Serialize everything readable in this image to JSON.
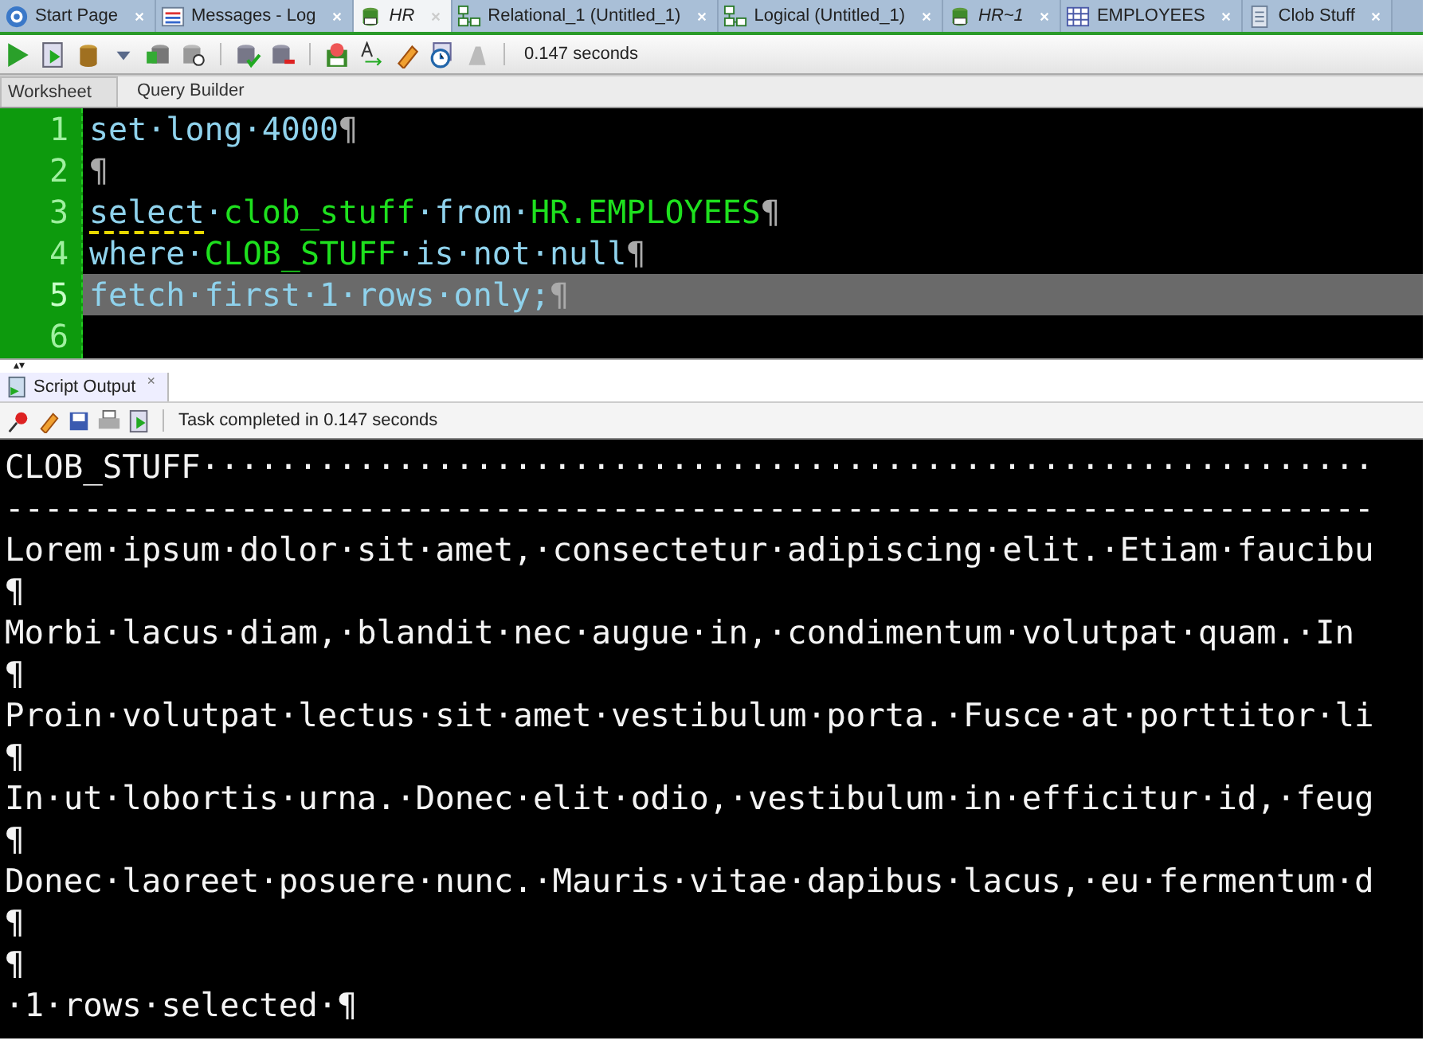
{
  "editor_tabs": [
    {
      "label": "Start Page",
      "italic": false,
      "selected": false
    },
    {
      "label": "Messages - Log",
      "italic": false,
      "selected": false
    },
    {
      "label": "HR",
      "italic": true,
      "selected": true
    },
    {
      "label": "Relational_1 (Untitled_1)",
      "italic": false,
      "selected": false
    },
    {
      "label": "Logical (Untitled_1)",
      "italic": false,
      "selected": false
    },
    {
      "label": "HR~1",
      "italic": true,
      "selected": false
    },
    {
      "label": "EMPLOYEES",
      "italic": false,
      "selected": false
    },
    {
      "label": "Clob Stuff",
      "italic": false,
      "selected": false
    }
  ],
  "toolbar": {
    "timing": "0.147 seconds"
  },
  "sub_tabs": [
    {
      "label": "Worksheet",
      "selected": true
    },
    {
      "label": "Query Builder",
      "selected": false
    }
  ],
  "editor": {
    "lines": [
      {
        "number": "1",
        "current": false,
        "segments": [
          {
            "kind": "keyword",
            "text": "set·long·4000"
          },
          {
            "kind": "marker",
            "text": "¶"
          }
        ]
      },
      {
        "number": "2",
        "current": false,
        "segments": [
          {
            "kind": "marker",
            "text": "¶"
          }
        ]
      },
      {
        "number": "3",
        "current": false,
        "segments": [
          {
            "kind": "keyword",
            "text": "select",
            "warning": true
          },
          {
            "kind": "keyword",
            "text": "·"
          },
          {
            "kind": "identifier",
            "text": "clob_stuff"
          },
          {
            "kind": "keyword",
            "text": "·from·"
          },
          {
            "kind": "identifier",
            "text": "HR.EMPLOYEES"
          },
          {
            "kind": "marker",
            "text": "¶"
          }
        ]
      },
      {
        "number": "4",
        "current": false,
        "segments": [
          {
            "kind": "keyword",
            "text": "where·"
          },
          {
            "kind": "identifier",
            "text": "CLOB_STUFF"
          },
          {
            "kind": "keyword",
            "text": "·is·not·null"
          },
          {
            "kind": "marker",
            "text": "¶"
          }
        ]
      },
      {
        "number": "5",
        "current": true,
        "segments": [
          {
            "kind": "keyword",
            "text": "fetch·first·1·rows·only;"
          },
          {
            "kind": "marker",
            "text": "¶"
          }
        ]
      },
      {
        "number": "6",
        "current": false
      }
    ]
  },
  "output_panel": {
    "tab": {
      "label": "Script Output",
      "close": "×"
    },
    "status": "Task completed in 0.147 seconds",
    "lines": [
      "CLOB_STUFF····························································",
      "----------------------------------------------------------------------",
      "Lorem·ipsum·dolor·sit·amet,·consectetur·adipiscing·elit.·Etiam·faucibu",
      "¶",
      "Morbi·lacus·diam,·blandit·nec·augue·in,·condimentum·volutpat·quam.·In",
      "¶",
      "Proin·volutpat·lectus·sit·amet·vestibulum·porta.·Fusce·at·porttitor·li",
      "¶",
      "In·ut·lobortis·urna.·Donec·elit·odio,·vestibulum·in·efficitur·id,·feug",
      "¶",
      "Donec·laoreet·posuere·nunc.·Mauris·vitae·dapibus·lacus,·eu·fermentum·d",
      "¶",
      "¶",
      "·1·rows·selected·¶"
    ]
  }
}
